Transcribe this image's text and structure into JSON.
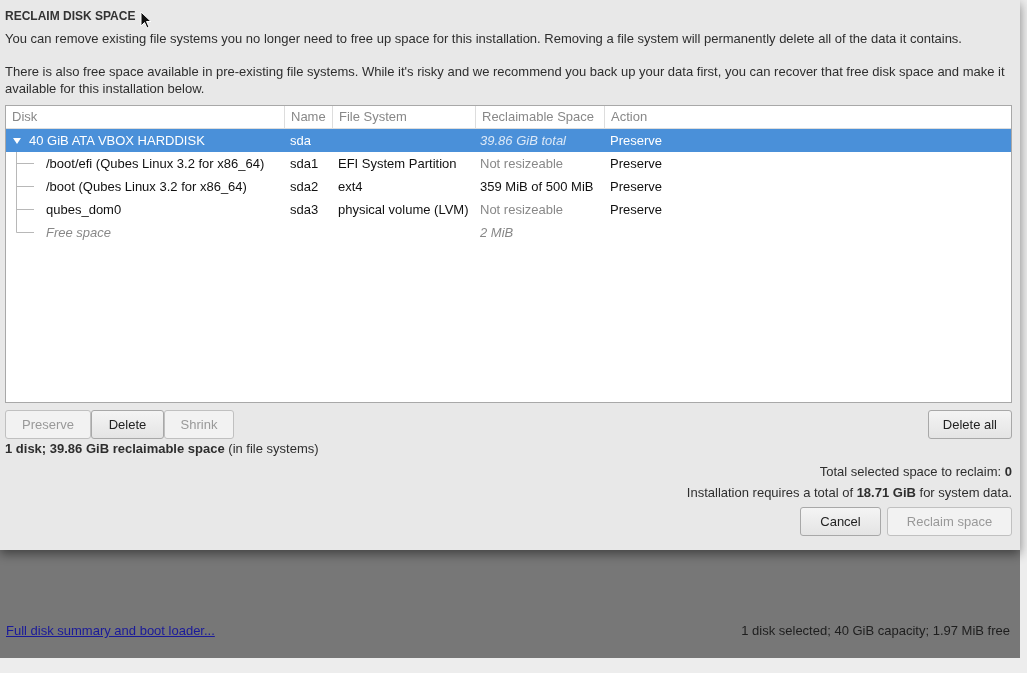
{
  "dialog": {
    "title": "RECLAIM DISK SPACE",
    "intro": "You can remove existing file systems you no longer need to free up space for this installation.  Removing a file system will permanently delete all of the data it contains.",
    "note": "There is also free space available in pre-existing file systems.  While it's risky and we recommend you back up your data first, you can recover that free disk space and make it available for this installation below.",
    "table": {
      "columns": [
        "Disk",
        "Name",
        "File System",
        "Reclaimable Space",
        "Action"
      ],
      "rows": [
        {
          "disk": "40 GiB ATA VBOX HARDDISK",
          "name": "sda",
          "file_system": "",
          "reclaimable": {
            "text": "39.86 GiB total",
            "kind": "total"
          },
          "action": "Preserve",
          "selected": true,
          "expanded": true,
          "children": [
            {
              "kind": "partition",
              "disk": "/boot/efi (Qubes Linux 3.2 for x86_64)",
              "name": "sda1",
              "file_system": "EFI System Partition",
              "reclaimable": {
                "text": "Not resizeable",
                "kind": "na"
              },
              "action": "Preserve"
            },
            {
              "kind": "partition",
              "disk": "/boot (Qubes Linux 3.2 for x86_64)",
              "name": "sda2",
              "file_system": "ext4",
              "reclaimable": {
                "text": "359 MiB of 500 MiB",
                "kind": "size"
              },
              "action": "Preserve"
            },
            {
              "kind": "partition",
              "disk": "qubes_dom0",
              "name": "sda3",
              "file_system": "physical volume (LVM)",
              "reclaimable": {
                "text": "Not resizeable",
                "kind": "na"
              },
              "action": "Preserve"
            },
            {
              "kind": "free",
              "disk": "Free space",
              "reclaimable": {
                "text": "2 MiB",
                "kind": "free"
              }
            }
          ]
        }
      ]
    },
    "row_buttons": [
      {
        "label": "Preserve",
        "disabled": true
      },
      {
        "label": "Delete",
        "disabled": false
      },
      {
        "label": "Shrink",
        "disabled": true
      }
    ],
    "delete_all": {
      "label": "Delete all",
      "disabled": false
    },
    "summary": "**1 disk; 39.86 GiB reclaimable space** (in file systems)",
    "total_selected": "Total selected space to reclaim: **0**",
    "requirement": "Installation requires a total of **18.71 GiB** for system data.",
    "buttons": [
      {
        "label": "Cancel",
        "disabled": false
      },
      {
        "label": "Reclaim space",
        "disabled": true
      }
    ]
  },
  "background": {
    "link": "Full disk summary and boot loader...",
    "status": "1 disk selected; 40 GiB capacity; 1.97 MiB free"
  }
}
